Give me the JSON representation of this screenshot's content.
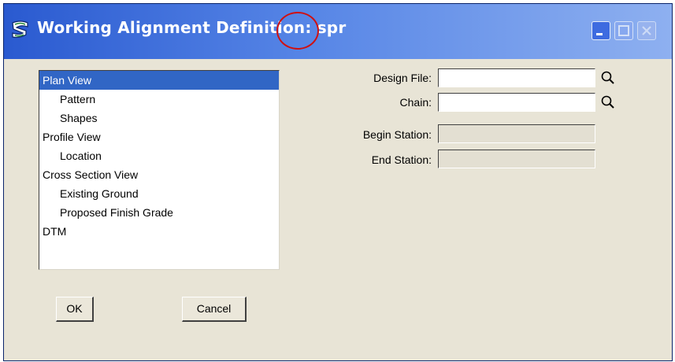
{
  "window": {
    "title": "Working Alignment Definition: spr",
    "icon": "app-logo-icon",
    "controls": [
      "minimize-icon",
      "maximize-icon",
      "close-icon"
    ]
  },
  "tree": {
    "items": [
      {
        "label": "Plan View",
        "selected": true
      },
      {
        "label": "Pattern"
      },
      {
        "label": "Shapes"
      },
      {
        "label": "Profile View"
      },
      {
        "label": "Location"
      },
      {
        "label": "Cross Section View"
      },
      {
        "label": "Existing Ground"
      },
      {
        "label": "Proposed Finish Grade"
      },
      {
        "label": "DTM"
      }
    ]
  },
  "fields": {
    "design_file": {
      "label": "Design File:",
      "value": ""
    },
    "chain": {
      "label": "Chain:",
      "value": ""
    },
    "begin_station": {
      "label": "Begin Station:",
      "value": ""
    },
    "end_station": {
      "label": "End Station:",
      "value": ""
    }
  },
  "buttons": {
    "ok": "OK",
    "cancel": "Cancel"
  },
  "colors": {
    "title_gradient_start": "#2a5ad0",
    "title_gradient_end": "#8eb0f0",
    "dialog_bg": "#e8e4d6",
    "selection": "#3166c5",
    "highlight_circle": "#d01010"
  }
}
